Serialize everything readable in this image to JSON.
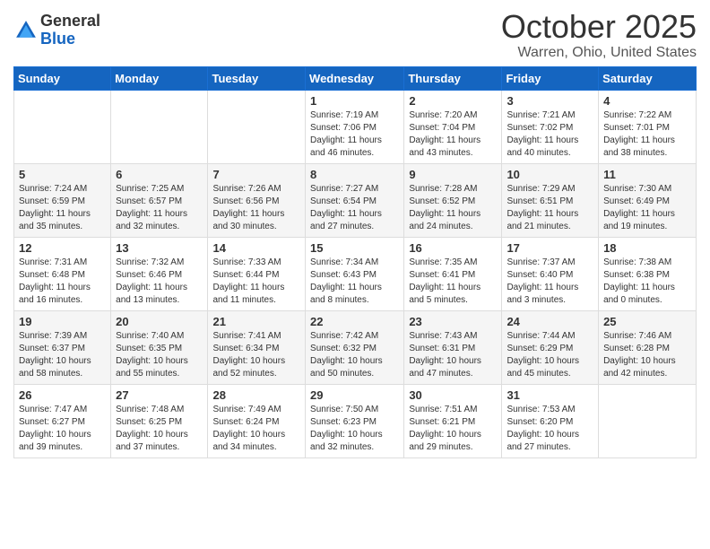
{
  "header": {
    "logo_general": "General",
    "logo_blue": "Blue",
    "month": "October 2025",
    "location": "Warren, Ohio, United States"
  },
  "days_of_week": [
    "Sunday",
    "Monday",
    "Tuesday",
    "Wednesday",
    "Thursday",
    "Friday",
    "Saturday"
  ],
  "weeks": [
    [
      {
        "day": "",
        "info": ""
      },
      {
        "day": "",
        "info": ""
      },
      {
        "day": "",
        "info": ""
      },
      {
        "day": "1",
        "info": "Sunrise: 7:19 AM\nSunset: 7:06 PM\nDaylight: 11 hours\nand 46 minutes."
      },
      {
        "day": "2",
        "info": "Sunrise: 7:20 AM\nSunset: 7:04 PM\nDaylight: 11 hours\nand 43 minutes."
      },
      {
        "day": "3",
        "info": "Sunrise: 7:21 AM\nSunset: 7:02 PM\nDaylight: 11 hours\nand 40 minutes."
      },
      {
        "day": "4",
        "info": "Sunrise: 7:22 AM\nSunset: 7:01 PM\nDaylight: 11 hours\nand 38 minutes."
      }
    ],
    [
      {
        "day": "5",
        "info": "Sunrise: 7:24 AM\nSunset: 6:59 PM\nDaylight: 11 hours\nand 35 minutes."
      },
      {
        "day": "6",
        "info": "Sunrise: 7:25 AM\nSunset: 6:57 PM\nDaylight: 11 hours\nand 32 minutes."
      },
      {
        "day": "7",
        "info": "Sunrise: 7:26 AM\nSunset: 6:56 PM\nDaylight: 11 hours\nand 30 minutes."
      },
      {
        "day": "8",
        "info": "Sunrise: 7:27 AM\nSunset: 6:54 PM\nDaylight: 11 hours\nand 27 minutes."
      },
      {
        "day": "9",
        "info": "Sunrise: 7:28 AM\nSunset: 6:52 PM\nDaylight: 11 hours\nand 24 minutes."
      },
      {
        "day": "10",
        "info": "Sunrise: 7:29 AM\nSunset: 6:51 PM\nDaylight: 11 hours\nand 21 minutes."
      },
      {
        "day": "11",
        "info": "Sunrise: 7:30 AM\nSunset: 6:49 PM\nDaylight: 11 hours\nand 19 minutes."
      }
    ],
    [
      {
        "day": "12",
        "info": "Sunrise: 7:31 AM\nSunset: 6:48 PM\nDaylight: 11 hours\nand 16 minutes."
      },
      {
        "day": "13",
        "info": "Sunrise: 7:32 AM\nSunset: 6:46 PM\nDaylight: 11 hours\nand 13 minutes."
      },
      {
        "day": "14",
        "info": "Sunrise: 7:33 AM\nSunset: 6:44 PM\nDaylight: 11 hours\nand 11 minutes."
      },
      {
        "day": "15",
        "info": "Sunrise: 7:34 AM\nSunset: 6:43 PM\nDaylight: 11 hours\nand 8 minutes."
      },
      {
        "day": "16",
        "info": "Sunrise: 7:35 AM\nSunset: 6:41 PM\nDaylight: 11 hours\nand 5 minutes."
      },
      {
        "day": "17",
        "info": "Sunrise: 7:37 AM\nSunset: 6:40 PM\nDaylight: 11 hours\nand 3 minutes."
      },
      {
        "day": "18",
        "info": "Sunrise: 7:38 AM\nSunset: 6:38 PM\nDaylight: 11 hours\nand 0 minutes."
      }
    ],
    [
      {
        "day": "19",
        "info": "Sunrise: 7:39 AM\nSunset: 6:37 PM\nDaylight: 10 hours\nand 58 minutes."
      },
      {
        "day": "20",
        "info": "Sunrise: 7:40 AM\nSunset: 6:35 PM\nDaylight: 10 hours\nand 55 minutes."
      },
      {
        "day": "21",
        "info": "Sunrise: 7:41 AM\nSunset: 6:34 PM\nDaylight: 10 hours\nand 52 minutes."
      },
      {
        "day": "22",
        "info": "Sunrise: 7:42 AM\nSunset: 6:32 PM\nDaylight: 10 hours\nand 50 minutes."
      },
      {
        "day": "23",
        "info": "Sunrise: 7:43 AM\nSunset: 6:31 PM\nDaylight: 10 hours\nand 47 minutes."
      },
      {
        "day": "24",
        "info": "Sunrise: 7:44 AM\nSunset: 6:29 PM\nDaylight: 10 hours\nand 45 minutes."
      },
      {
        "day": "25",
        "info": "Sunrise: 7:46 AM\nSunset: 6:28 PM\nDaylight: 10 hours\nand 42 minutes."
      }
    ],
    [
      {
        "day": "26",
        "info": "Sunrise: 7:47 AM\nSunset: 6:27 PM\nDaylight: 10 hours\nand 39 minutes."
      },
      {
        "day": "27",
        "info": "Sunrise: 7:48 AM\nSunset: 6:25 PM\nDaylight: 10 hours\nand 37 minutes."
      },
      {
        "day": "28",
        "info": "Sunrise: 7:49 AM\nSunset: 6:24 PM\nDaylight: 10 hours\nand 34 minutes."
      },
      {
        "day": "29",
        "info": "Sunrise: 7:50 AM\nSunset: 6:23 PM\nDaylight: 10 hours\nand 32 minutes."
      },
      {
        "day": "30",
        "info": "Sunrise: 7:51 AM\nSunset: 6:21 PM\nDaylight: 10 hours\nand 29 minutes."
      },
      {
        "day": "31",
        "info": "Sunrise: 7:53 AM\nSunset: 6:20 PM\nDaylight: 10 hours\nand 27 minutes."
      },
      {
        "day": "",
        "info": ""
      }
    ]
  ]
}
